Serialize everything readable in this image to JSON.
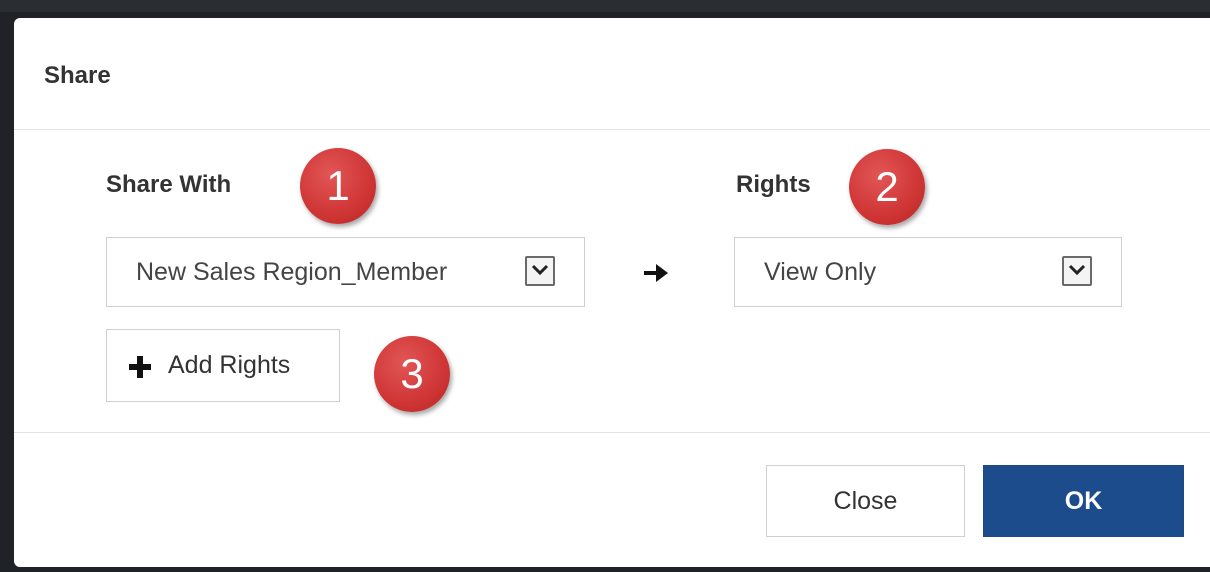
{
  "dialog": {
    "title": "Share"
  },
  "share_with": {
    "label": "Share With",
    "selected": "New Sales Region_Member"
  },
  "rights": {
    "label": "Rights",
    "selected": "View Only"
  },
  "add_rights": {
    "label": "Add Rights"
  },
  "badges": [
    "1",
    "2",
    "3"
  ],
  "footer": {
    "close_label": "Close",
    "ok_label": "OK"
  },
  "colors": {
    "primary": "#1d4c8c",
    "badge": "#cf3535"
  },
  "icons": {
    "dropdown": "chevron-down-icon",
    "arrow": "arrow-right-icon",
    "add": "plus-icon"
  }
}
